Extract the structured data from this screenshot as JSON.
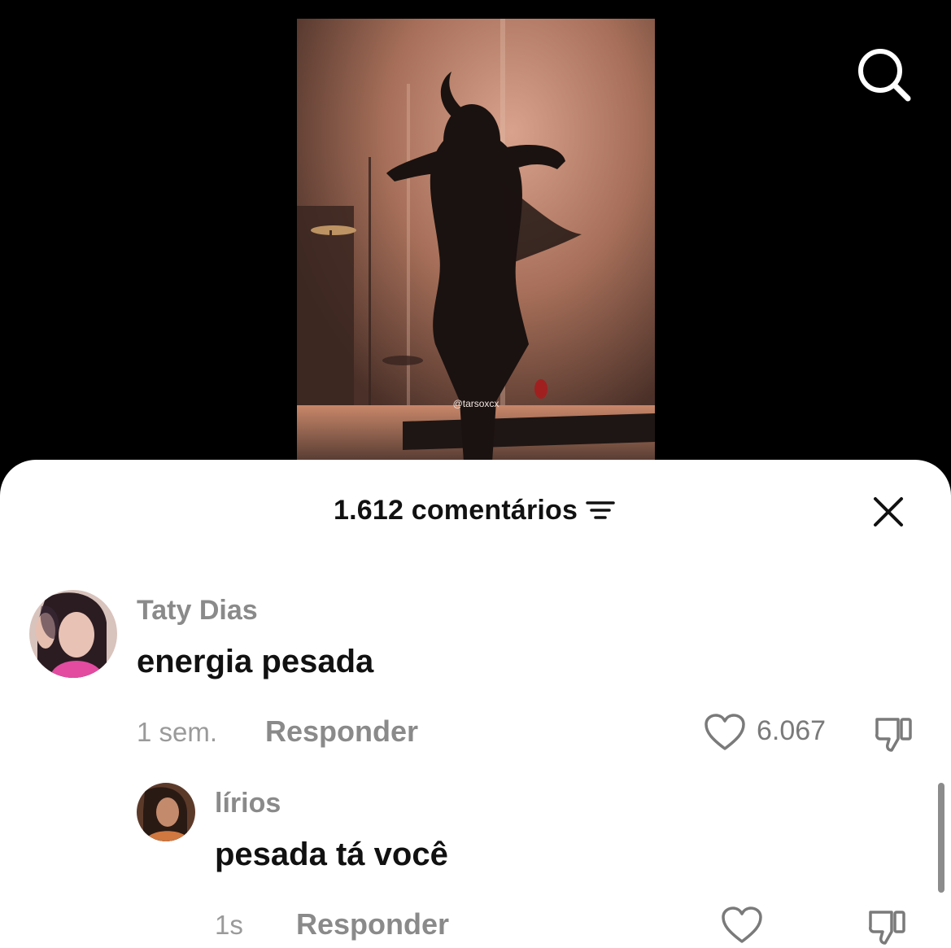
{
  "video": {
    "watermark": "@tarsoxcx"
  },
  "header": {
    "comment_count": "1.612 comentários",
    "icons": {
      "sort": "sort-lines-icon",
      "close": "close-icon",
      "search": "search-icon"
    }
  },
  "comments": [
    {
      "username": "Taty Dias",
      "text": "energia pesada",
      "time": "1 sem.",
      "reply_label": "Responder",
      "likes": "6.067"
    },
    {
      "username": "lírios",
      "text": "pesada tá você",
      "time": "1s",
      "reply_label": "Responder",
      "likes": ""
    }
  ],
  "colors": {
    "sheet_bg": "#ffffff",
    "username": "#8a8a8a",
    "text": "#111111"
  }
}
